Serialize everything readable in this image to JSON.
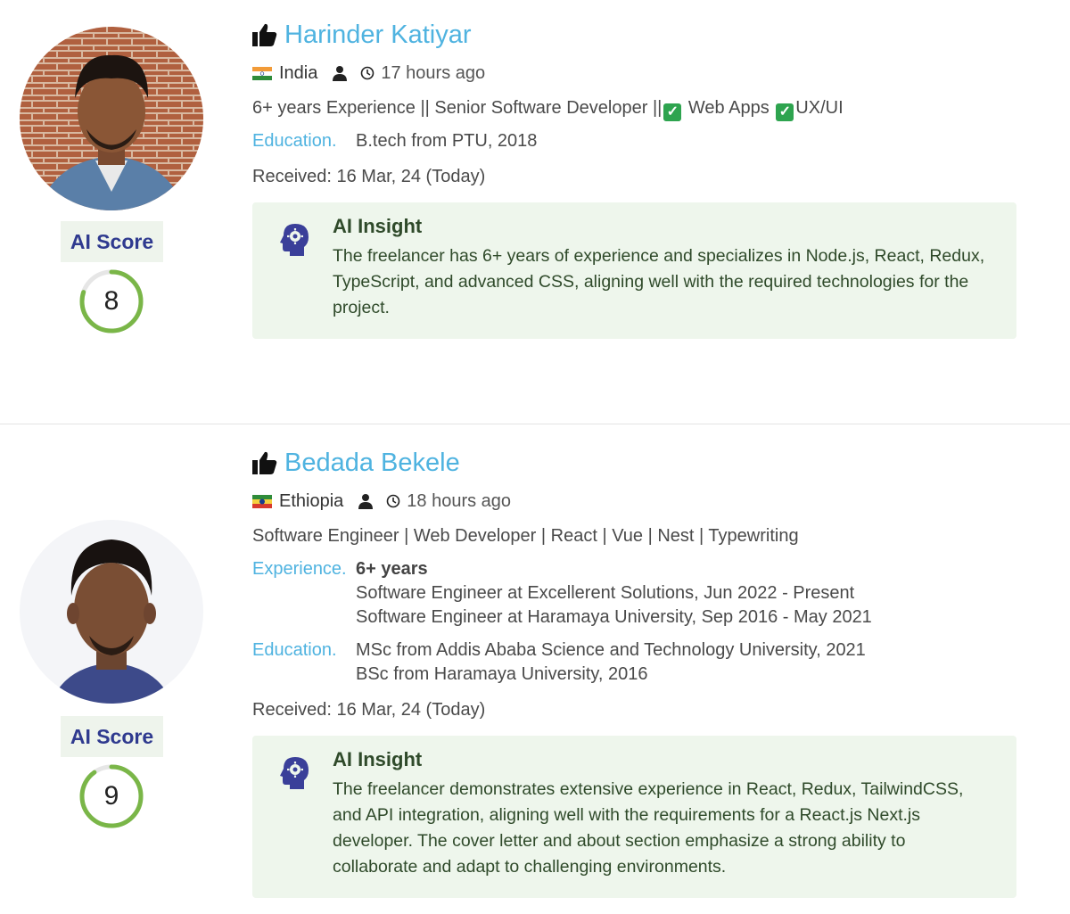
{
  "candidates": [
    {
      "name": "Harinder Katiyar",
      "country": "India",
      "time_ago": "17 hours ago",
      "headline": "6+ years Experience || Senior Software Developer ||",
      "headline_tail_1": " Web Apps ",
      "headline_tail_2": "UX/UI",
      "education_label": "Education.",
      "education": [
        "B.tech from PTU, 2018"
      ],
      "received": "Received: 16 Mar, 24 (Today)",
      "ai_score_label": "AI Score",
      "ai_score": 8,
      "ai_score_max": 10,
      "insight_title": "AI Insight",
      "insight_text": "The freelancer has 6+ years of experience and specializes in Node.js, React, Redux, TypeScript, and advanced CSS, aligning well with the required technologies for the project."
    },
    {
      "name": "Bedada Bekele",
      "country": "Ethiopia",
      "time_ago": "18 hours ago",
      "headline": "Software Engineer | Web Developer | React | Vue | Nest | Typewriting",
      "experience_label": "Experience.",
      "experience_total": "6+ years",
      "experience": [
        "Software Engineer at Excellerent Solutions, Jun 2022 - Present",
        "Software Engineer at Haramaya University, Sep 2016 - May 2021"
      ],
      "education_label": "Education.",
      "education": [
        "MSc from Addis Ababa Science and Technology University, 2021",
        "BSc from Haramaya University, 2016"
      ],
      "received": "Received: 16 Mar, 24 (Today)",
      "ai_score_label": "AI Score",
      "ai_score": 9,
      "ai_score_max": 10,
      "insight_title": "AI Insight",
      "insight_text": "The freelancer demonstrates extensive experience in React, Redux, TailwindCSS, and API integration, aligning well with the requirements for a React.js Next.js developer. The cover letter and about section emphasize a strong ability to collaborate and adapt to challenging environments."
    }
  ],
  "colors": {
    "name": "#4fb3e0",
    "score_ring": "#7ab648",
    "score_ring_track": "#e6e6e6",
    "ai_score_text": "#2f3a8f",
    "insight_bg": "#eef6ec",
    "insight_icon": "#3a3f99"
  },
  "icons": {
    "thumb": "thumbs-up-icon",
    "person": "person-icon",
    "clock": "clock-icon",
    "insight": "head-gear-icon",
    "check": "check-box-icon"
  }
}
